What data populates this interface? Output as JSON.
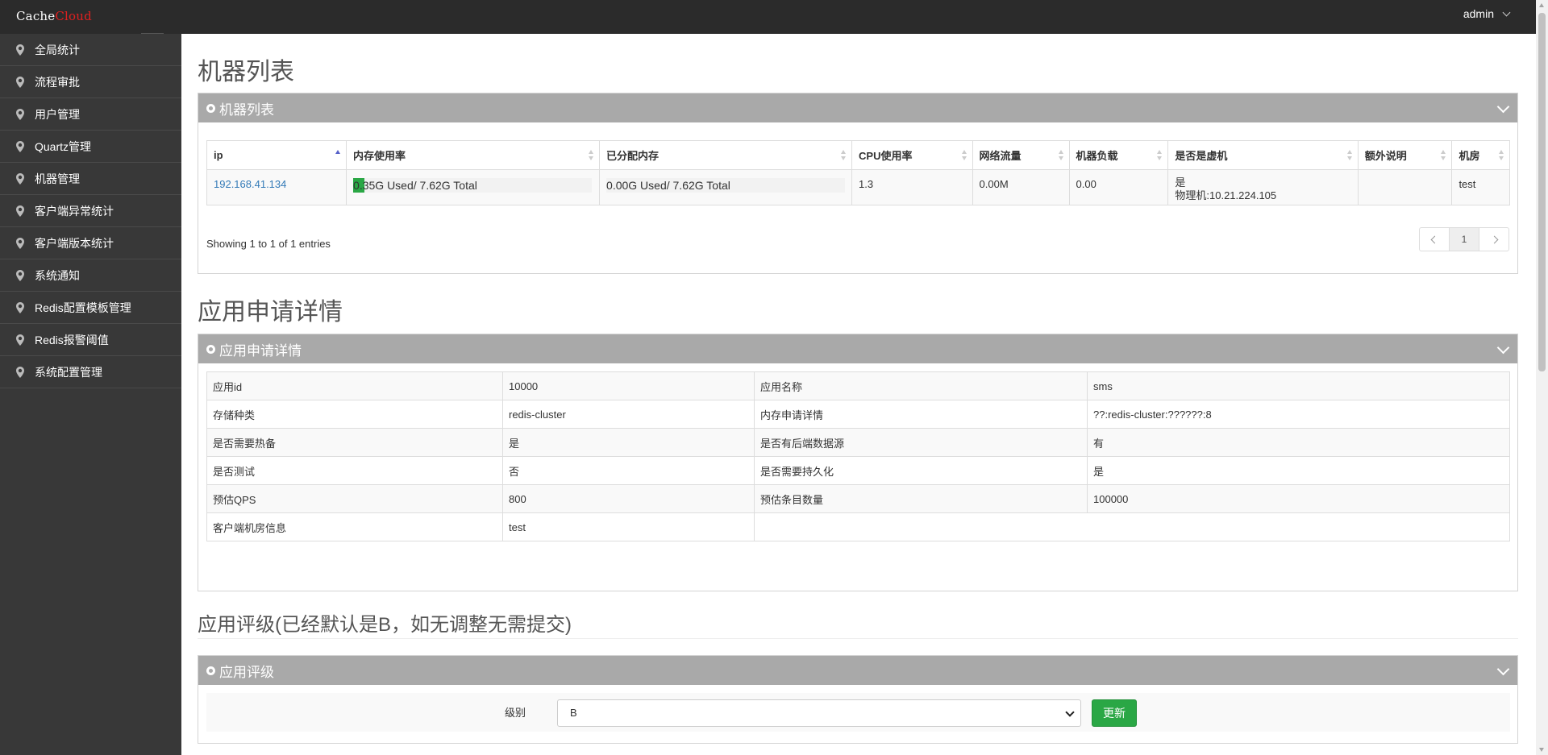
{
  "navbar": {
    "brand_a": "Cache",
    "brand_b": "Cloud",
    "user": "admin"
  },
  "sidebar": {
    "items": [
      {
        "label": "全局统计"
      },
      {
        "label": "流程审批"
      },
      {
        "label": "用户管理"
      },
      {
        "label": "Quartz管理"
      },
      {
        "label": "机器管理"
      },
      {
        "label": "客户端异常统计"
      },
      {
        "label": "客户端版本统计"
      },
      {
        "label": "系统通知"
      },
      {
        "label": "Redis配置模板管理"
      },
      {
        "label": "Redis报警阈值"
      },
      {
        "label": "系统配置管理"
      }
    ]
  },
  "machines": {
    "page_title": "机器列表",
    "panel_title": "机器列表",
    "columns": [
      "ip",
      "内存使用率",
      "已分配内存",
      "CPU使用率",
      "网络流量",
      "机器负载",
      "是否是虚机",
      "额外说明",
      "机房"
    ],
    "row": {
      "ip": "192.168.41.134",
      "mem_usage": "0.35G  Used/ 7.62G  Total",
      "mem_usage_fraction": 0.046,
      "mem_alloc": "0.00G  Used/ 7.62G  Total",
      "cpu": "1.3",
      "network": "0.00M",
      "load": "0.00",
      "is_vm": "是",
      "physical": "物理机:10.21.224.105",
      "extra": "",
      "room": "test"
    },
    "showing": "Showing 1 to 1 of 1 entries",
    "page": "1"
  },
  "app_detail": {
    "page_title": "应用申请详情",
    "panel_title": "应用申请详情",
    "rows": [
      [
        "应用id",
        "10000",
        "应用名称",
        "sms"
      ],
      [
        "存储种类",
        "redis-cluster",
        "内存申请详情",
        "??:redis-cluster:??????:8"
      ],
      [
        "是否需要热备",
        "是",
        "是否有后端数据源",
        "有"
      ],
      [
        "是否测试",
        "否",
        "是否需要持久化",
        "是"
      ],
      [
        "预估QPS",
        "800",
        "预估条目数量",
        "100000"
      ],
      [
        "客户端机房信息",
        "test"
      ]
    ]
  },
  "rating": {
    "page_title": "应用评级(已经默认是B，如无调整无需提交)",
    "panel_title": "应用评级",
    "label": "级别",
    "selected": "B",
    "button": "更新"
  },
  "colors": {
    "navbar": "#2b2b2b",
    "sidebar": "#383838",
    "panel_head": "#a9a9a9",
    "accent_green": "#2aa745",
    "link": "#337ab7",
    "warn_red": "#d9302c"
  }
}
